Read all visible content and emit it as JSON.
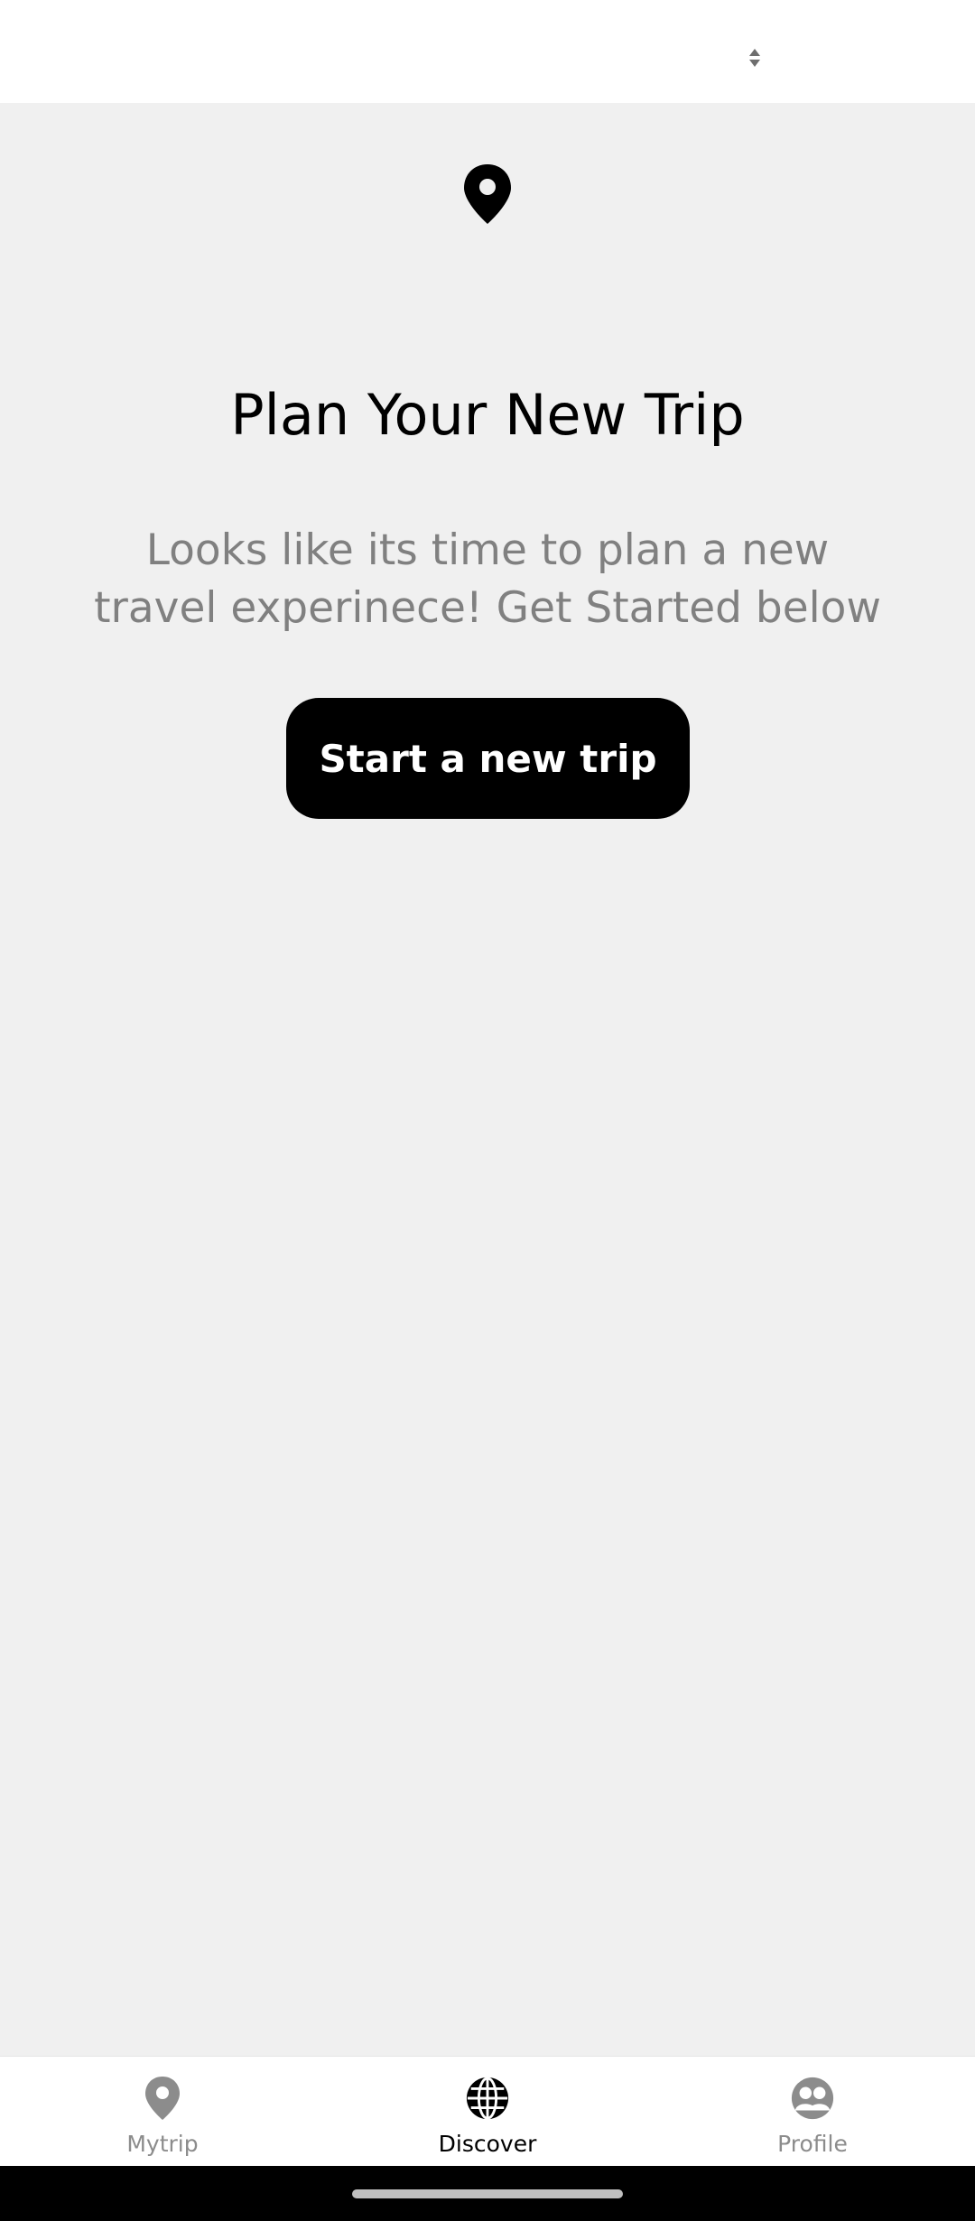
{
  "top_bar": {
    "sort_icon": "sort-arrows-icon"
  },
  "empty_state": {
    "icon": "location-pin-icon",
    "title": "Plan Your New Trip",
    "subtitle": "Looks like its time to plan a new travel experinece! Get Started below",
    "cta_label": "Start a new trip"
  },
  "bottom_nav": {
    "items": [
      {
        "label": "Mytrip",
        "icon": "location-pin-icon",
        "active": false
      },
      {
        "label": "Discover",
        "icon": "globe-icon",
        "active": true
      },
      {
        "label": "Profile",
        "icon": "people-icon",
        "active": false
      }
    ]
  },
  "colors": {
    "background": "#f0f0f0",
    "accent": "#000000",
    "inactive": "#8c8c8c",
    "subtitle": "#808080"
  }
}
